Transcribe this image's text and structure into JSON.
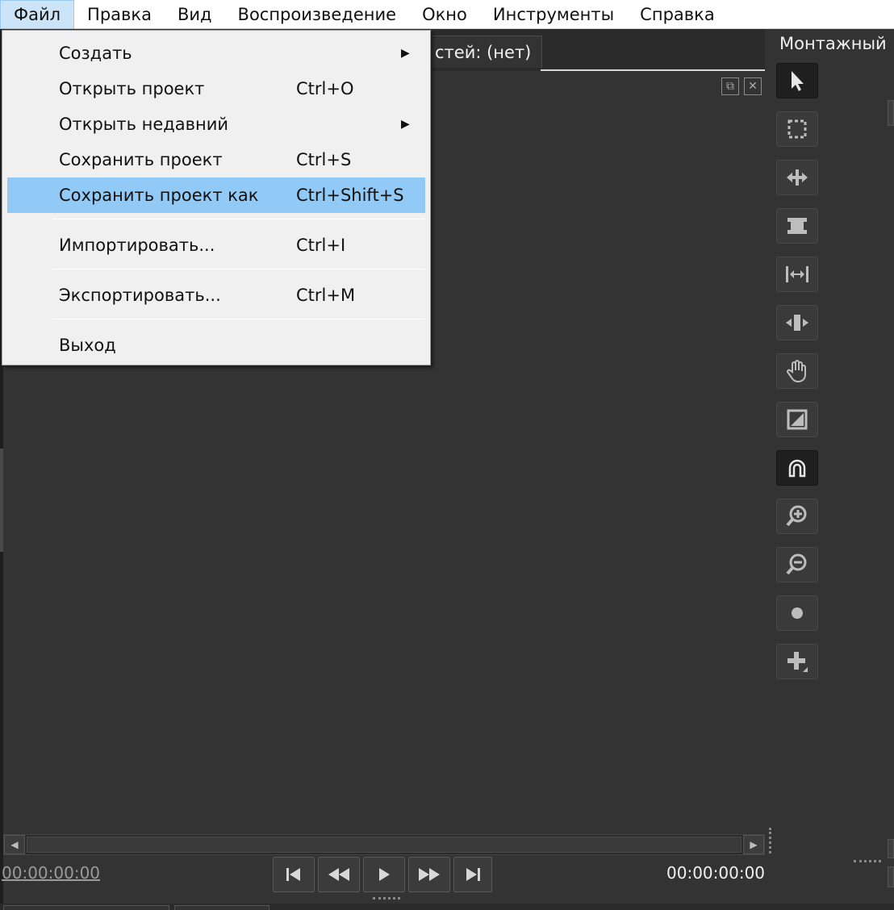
{
  "menubar": {
    "items": [
      "Файл",
      "Правка",
      "Вид",
      "Воспроизведение",
      "Окно",
      "Инструменты",
      "Справка"
    ]
  },
  "file_menu": {
    "items": [
      {
        "label": "Создать",
        "shortcut": "",
        "submenu": true
      },
      {
        "label": "Открыть проект",
        "shortcut": "Ctrl+O",
        "submenu": false
      },
      {
        "label": "Открыть недавний",
        "shortcut": "",
        "submenu": true
      },
      {
        "label": "Сохранить проект",
        "shortcut": "Ctrl+S",
        "submenu": false
      },
      {
        "label": "Сохранить проект как",
        "shortcut": "Ctrl+Shift+S",
        "submenu": false,
        "highlighted": true
      },
      {
        "label": "Импортировать...",
        "shortcut": "Ctrl+I",
        "submenu": false
      },
      {
        "label": "Экспортировать...",
        "shortcut": "Ctrl+M",
        "submenu": false
      },
      {
        "label": "Выход",
        "shortcut": "",
        "submenu": false
      }
    ]
  },
  "timeline": {
    "tab_label": "стей: (нет)",
    "timecode_start": "00:00:00:00",
    "timecode_end": "00:00:00:00"
  },
  "toolbar": {
    "title": "Монтажный",
    "tools": [
      "pointer-tool-icon",
      "selection-box-icon",
      "ripple-edit-icon",
      "trim-icon",
      "stretch-icon",
      "slide-icon",
      "hand-icon",
      "fade-icon",
      "snap-magnet-icon",
      "zoom-in-icon",
      "zoom-out-icon",
      "marker-dot-icon",
      "add-icon"
    ],
    "selected": [
      "pointer-tool-icon",
      "snap-magnet-icon"
    ]
  },
  "transport": [
    "go-to-start-icon",
    "rewind-icon",
    "play-icon",
    "fast-forward-icon",
    "go-to-end-icon"
  ],
  "colors": {
    "menu_highlight": "#91c9f7",
    "menubar_active": "#cce4f7",
    "background": "#333333"
  }
}
